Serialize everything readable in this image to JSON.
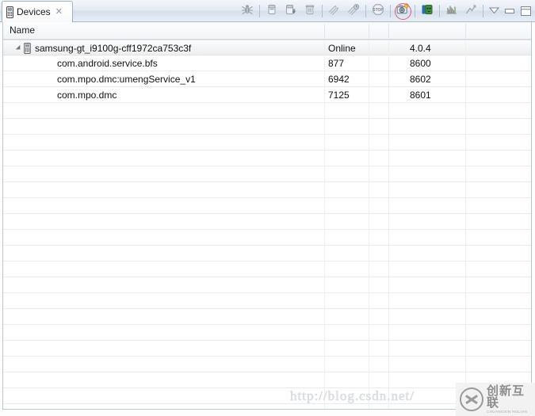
{
  "window": {
    "tab": {
      "label": "Devices",
      "close_glyph": "✕",
      "icon": "phone-icon"
    }
  },
  "toolbar": {
    "buttons": [
      {
        "name": "debug-process-button",
        "icon": "bug-icon",
        "title": "Debug selected process"
      },
      {
        "name": "update-heap-button",
        "icon": "heap-icon",
        "title": "Update Heap"
      },
      {
        "name": "dump-hprof-button",
        "icon": "hprof-icon",
        "title": "Dump HPROF file"
      },
      {
        "name": "cause-gc-button",
        "icon": "trash-icon",
        "title": "Cause GC"
      },
      {
        "name": "update-threads-button",
        "icon": "threads-icon",
        "title": "Update Threads"
      },
      {
        "name": "start-method-profiling-button",
        "icon": "method-profiling-icon",
        "title": "Start Method Profiling"
      },
      {
        "name": "stop-process-button",
        "icon": "stop-icon",
        "title": "Stop Process"
      },
      {
        "name": "screen-capture-button",
        "icon": "camera-icon",
        "title": "Screen Capture",
        "highlighted": true
      },
      {
        "name": "dump-view-hierarchy-button",
        "icon": "view-hierarchy-icon",
        "title": "Dump View Hierarchy for UI Automator"
      },
      {
        "name": "capture-opengl-button",
        "icon": "opengl-trace-icon",
        "title": "Capture OpenGL ES traces"
      },
      {
        "name": "reset-adb-button",
        "icon": "reset-adb-icon",
        "title": "Reset adb"
      }
    ],
    "view_menu_label": "View Menu",
    "minimize_label": "Minimize",
    "maximize_label": "Maximize"
  },
  "table": {
    "columns": [
      {
        "key": "name",
        "label": "Name"
      },
      {
        "key": "col_a",
        "label": ""
      },
      {
        "key": "col_b",
        "label": ""
      },
      {
        "key": "col_c",
        "label": ""
      },
      {
        "key": "col_d",
        "label": ""
      }
    ],
    "rows": [
      {
        "type": "device",
        "name": "samsung-gt_i9100g-cff1972ca753c3f",
        "col_a": "Online",
        "col_b": "",
        "col_c": "4.0.4",
        "col_d": "",
        "selected": true,
        "expanded": true
      },
      {
        "type": "process",
        "name": "com.android.service.bfs",
        "col_a": "877",
        "col_b": "",
        "col_c": "8600",
        "col_d": "",
        "selected": false
      },
      {
        "type": "process",
        "name": "com.mpo.dmc:umengService_v1",
        "col_a": "6942",
        "col_b": "",
        "col_c": "8602",
        "col_d": "",
        "selected": false
      },
      {
        "type": "process",
        "name": "com.mpo.dmc",
        "col_a": "7125",
        "col_b": "",
        "col_c": "8601",
        "col_d": "",
        "selected": false
      }
    ],
    "empty_row_count": 19
  },
  "watermark": {
    "url_text": "http://blog.csdn.net/",
    "logo_cn": "创新互联",
    "logo_en": "CHUANGXIN HULIAN"
  },
  "colors": {
    "toolbar_top": "#f4f7fb",
    "toolbar_bottom": "#d5dfec",
    "border": "#b9c6d6",
    "grid_line": "#e9ecef",
    "highlight_ring": "#d9607c",
    "selected_row": "#eceef1"
  }
}
